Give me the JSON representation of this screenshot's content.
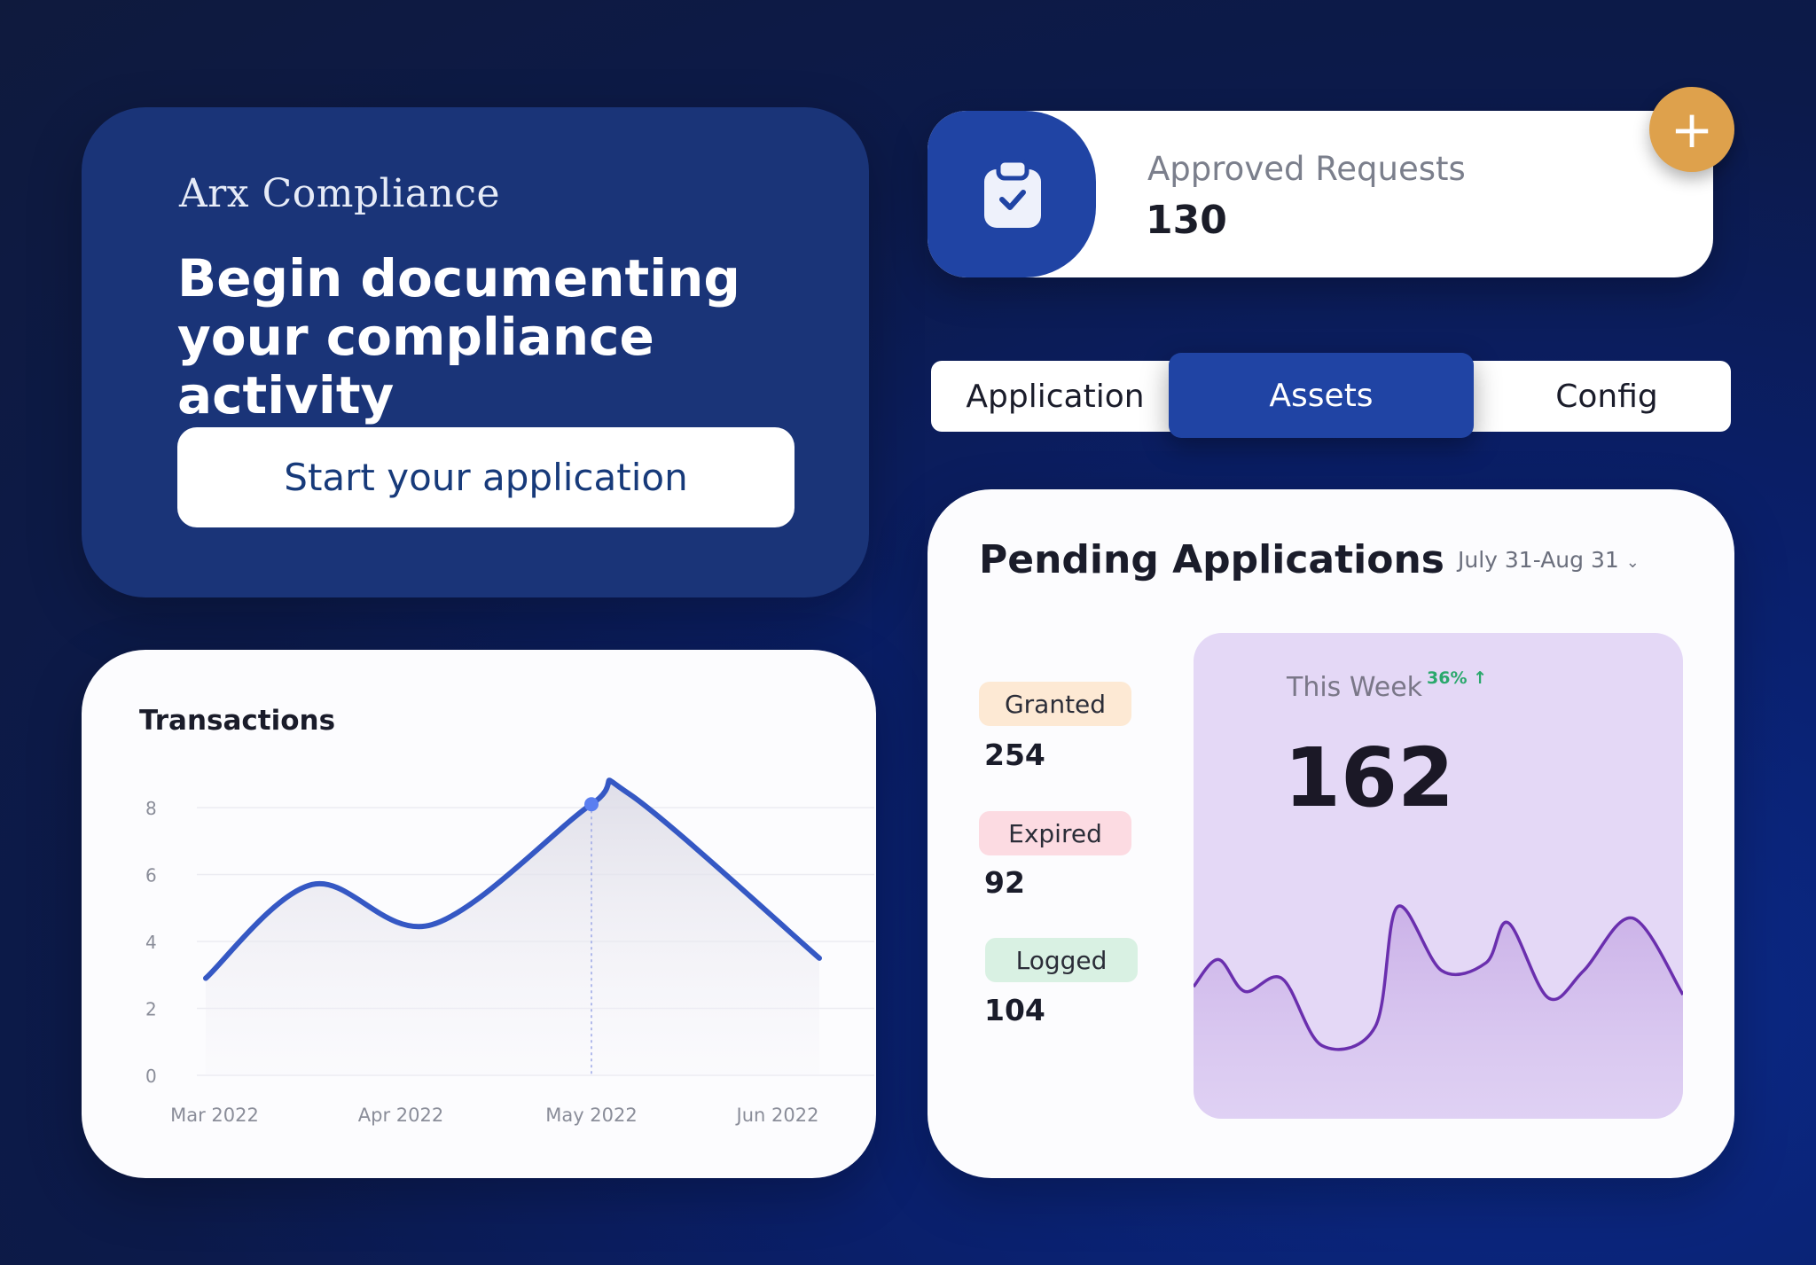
{
  "hero": {
    "brand": "Arx Compliance",
    "headline": "Begin documenting your compliance activity",
    "cta_label": "Start your application"
  },
  "approved": {
    "label": "Approved Requests",
    "value": "130",
    "icon": "clipboard-check-icon",
    "add_icon": "plus-icon"
  },
  "tabs": [
    {
      "label": "Application",
      "active": false
    },
    {
      "label": "Assets",
      "active": true
    },
    {
      "label": "Config",
      "active": false
    }
  ],
  "transactions": {
    "title": "Transactions",
    "chart_data": {
      "type": "area",
      "title": "Transactions",
      "x": [
        "Mar 2022",
        "Apr 2022",
        "May 2022",
        "Jun 2022"
      ],
      "ylim": [
        0,
        8
      ],
      "yticks": [
        "0",
        "2",
        "4",
        "6",
        "8"
      ],
      "points": [
        {
          "x": "Mar 2022",
          "y": 2.9
        },
        {
          "x": "",
          "y": 5.7
        },
        {
          "x": "Apr 2022",
          "y": 4.5
        },
        {
          "x": "May 2022",
          "y": 8.1
        },
        {
          "x": "",
          "y": 8.4
        },
        {
          "x": "Jun 2022",
          "y": 3.5
        }
      ],
      "highlight": {
        "x": "May 2022",
        "y": 8.1
      },
      "colors": {
        "line": "#3558c4",
        "marker": "#5a7ef0"
      }
    }
  },
  "pending": {
    "title": "Pending Applications",
    "range": "July 31-Aug 31",
    "stats": [
      {
        "label": "Granted",
        "value": "254",
        "color": "#fde9d4"
      },
      {
        "label": "Expired",
        "value": "92",
        "color": "#fcdbe2"
      },
      {
        "label": "Logged",
        "value": "104",
        "color": "#d9f1e3"
      }
    ],
    "week": {
      "label": "This Week",
      "change": "36% ↑",
      "value": "162",
      "sparkline": [
        0.45,
        0.62,
        0.42,
        0.5,
        0.08,
        0.2,
        0.95,
        0.55,
        0.6,
        0.85,
        0.38,
        0.55,
        0.88,
        0.4
      ],
      "color": "#6a2fae"
    }
  }
}
